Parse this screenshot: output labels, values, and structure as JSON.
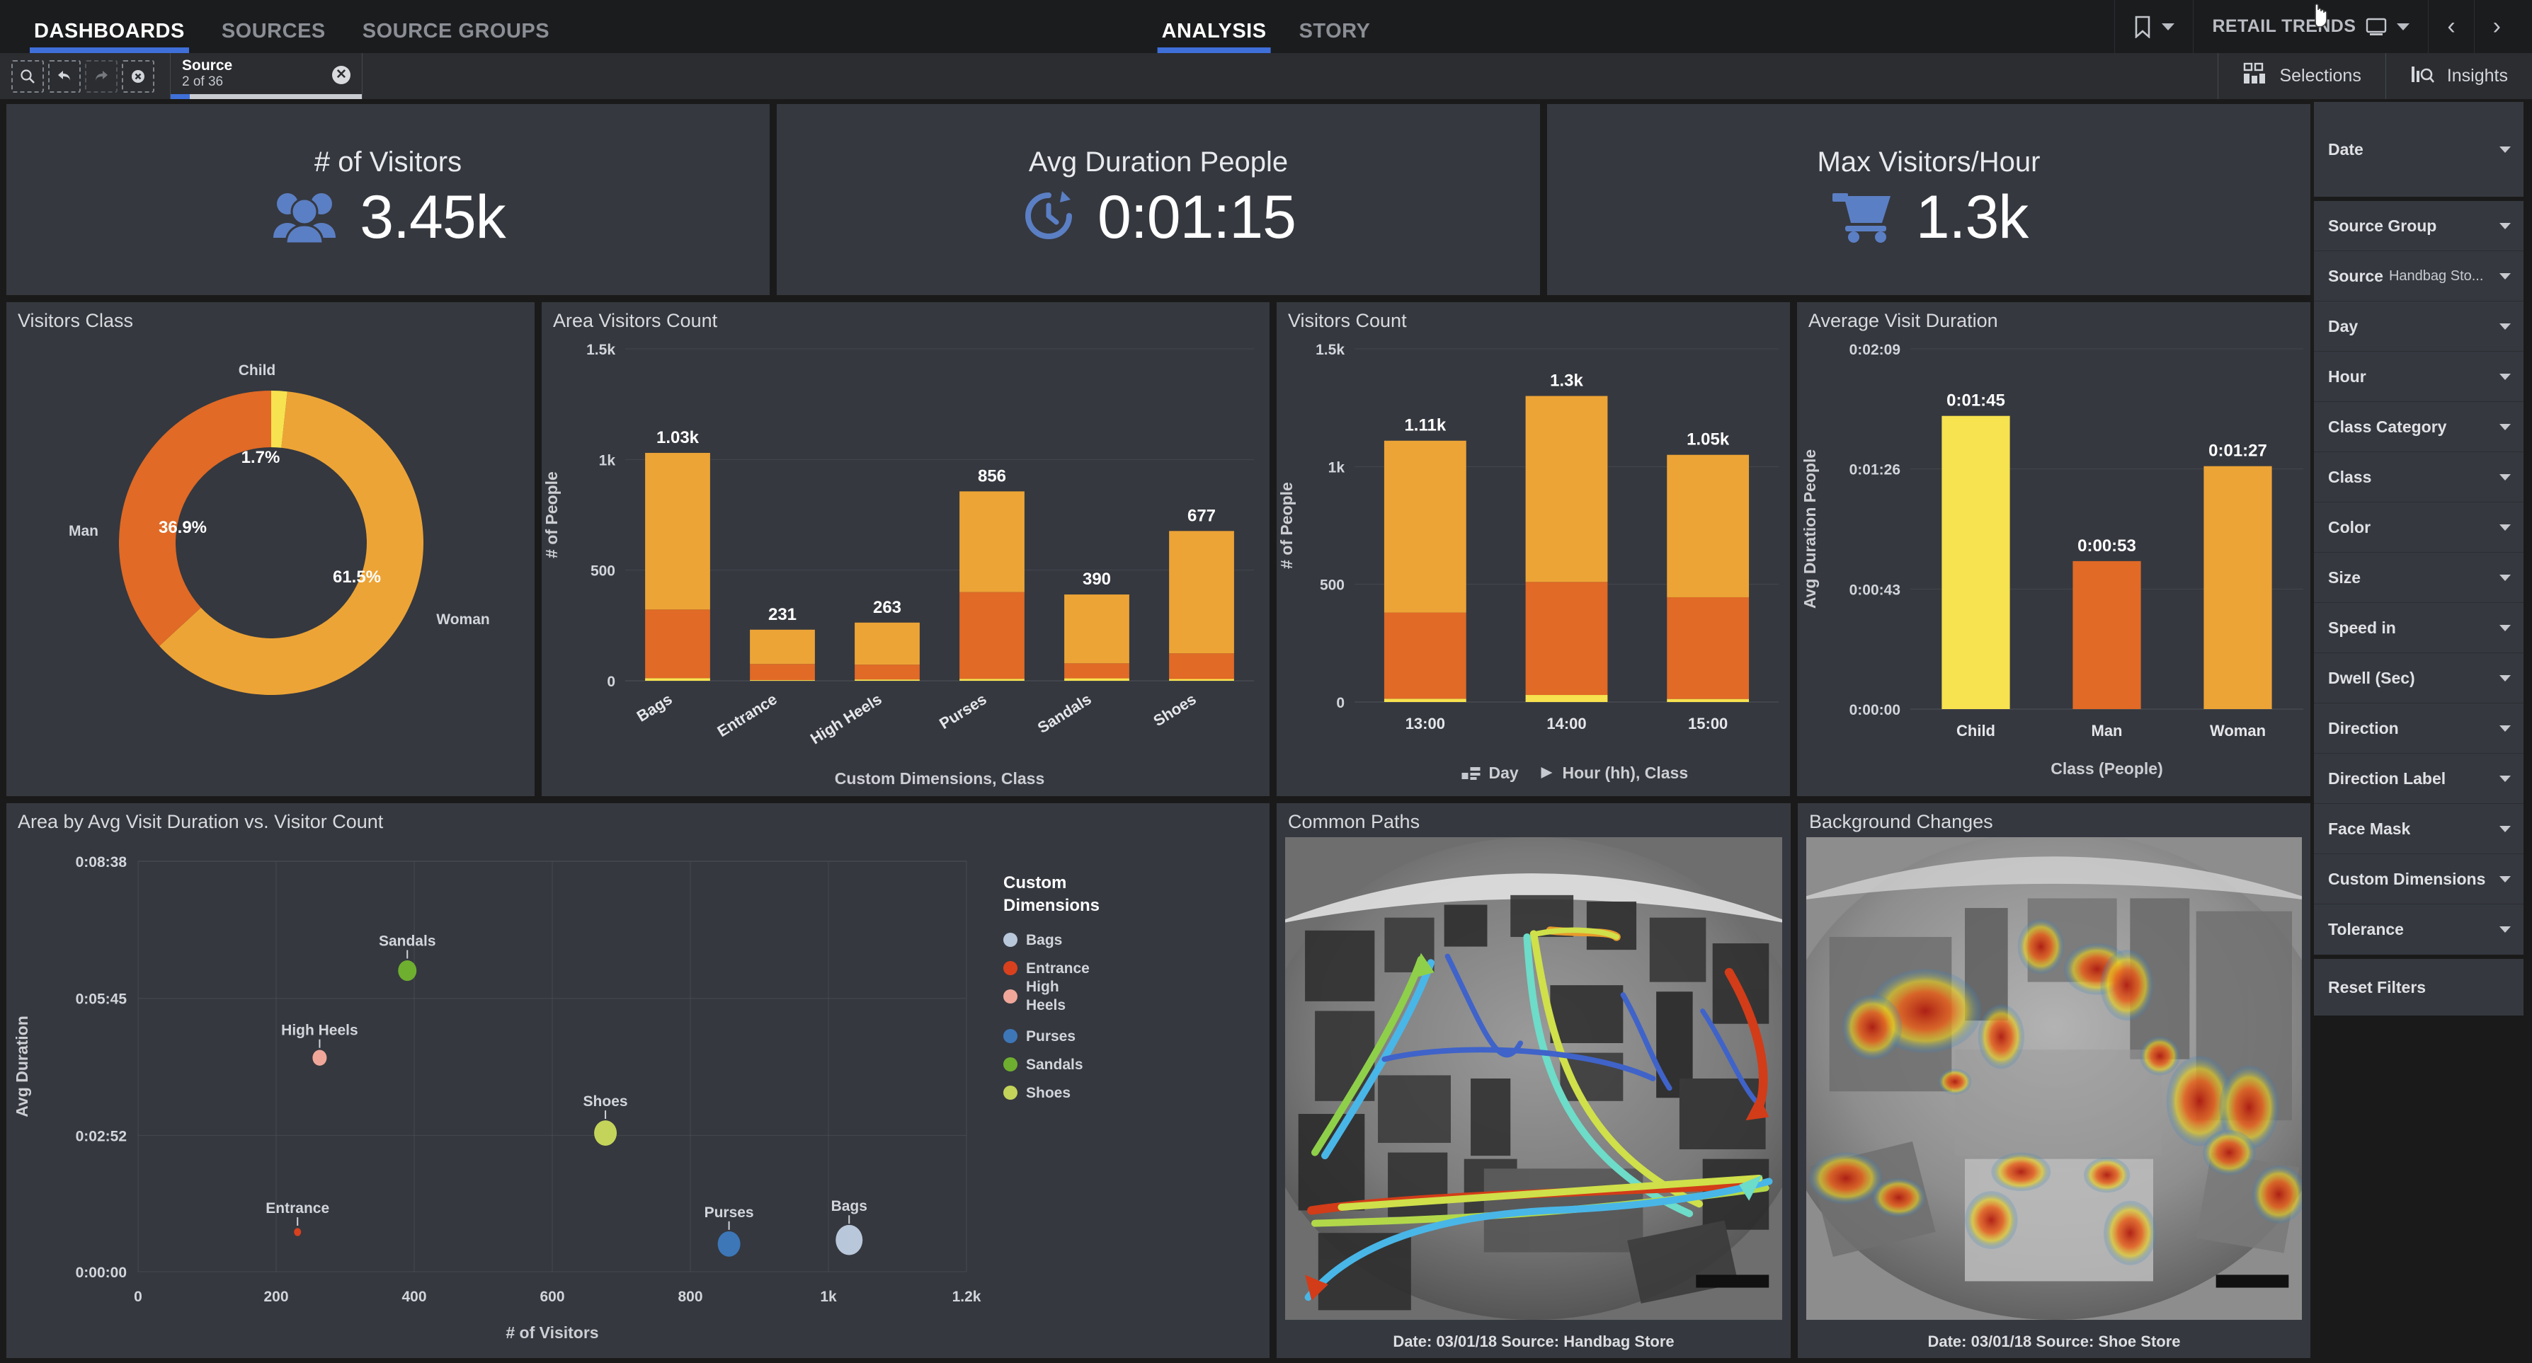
{
  "nav": {
    "left_items": [
      {
        "label": "DASHBOARDS",
        "active": true
      },
      {
        "label": "SOURCES",
        "active": false
      },
      {
        "label": "SOURCE GROUPS",
        "active": false
      }
    ],
    "center_items": [
      {
        "label": "ANALYSIS",
        "active": true
      },
      {
        "label": "STORY",
        "active": false
      }
    ],
    "bookmark_icon": "bookmark-icon",
    "sheet_title": "RETAIL TRENDS",
    "sheet_icon": "sheet-icon",
    "prev_label": "‹",
    "next_label": "›"
  },
  "toolbar": {
    "tools": [
      {
        "name": "search-selections-icon",
        "dim": false
      },
      {
        "name": "step-back-icon",
        "dim": false
      },
      {
        "name": "step-forward-icon",
        "dim": true
      },
      {
        "name": "clear-selections-icon",
        "dim": false
      }
    ],
    "selection_chip": {
      "field": "Source",
      "detail": "2 of 36",
      "clear": "✕"
    },
    "selections_label": "Selections",
    "insights_label": "Insights"
  },
  "kpis": [
    {
      "label": "# of Visitors",
      "value": "3.45k",
      "icon": "people-group-icon",
      "color": "#5b7fc4"
    },
    {
      "label": "Avg Duration People",
      "value": "0:01:15",
      "icon": "clock-refresh-icon",
      "color": "#5b7fc4"
    },
    {
      "label": "Max Visitors/Hour",
      "value": "1.3k",
      "icon": "shopping-cart-icon",
      "color": "#5b7fc4"
    }
  ],
  "panels": {
    "visitors_class": "Visitors Class",
    "area_visitors_count": "Area Visitors Count",
    "visitors_count": "Visitors Count",
    "average_visit_duration": "Average Visit Duration",
    "scatter": "Area by Avg Visit Duration vs. Visitor Count",
    "common_paths": "Common Paths",
    "background_changes": "Background Changes"
  },
  "common_paths_caption": "Date: 03/01/18 Source: Handbag Store",
  "background_changes_caption": "Date: 03/01/18 Source: Shoe Store",
  "filters": {
    "date": {
      "label": "Date"
    },
    "items": [
      {
        "label": "Source Group",
        "value": ""
      },
      {
        "label": "Source",
        "value": "Handbag Sto..."
      },
      {
        "label": "Day",
        "value": ""
      },
      {
        "label": "Hour",
        "value": ""
      },
      {
        "label": "Class Category",
        "value": ""
      },
      {
        "label": "Class",
        "value": ""
      },
      {
        "label": "Color",
        "value": ""
      },
      {
        "label": "Size",
        "value": ""
      },
      {
        "label": "Speed in",
        "value": ""
      },
      {
        "label": "Dwell (Sec)",
        "value": ""
      },
      {
        "label": "Direction",
        "value": ""
      },
      {
        "label": "Direction Label",
        "value": ""
      },
      {
        "label": "Face Mask",
        "value": ""
      },
      {
        "label": "Custom Dimensions",
        "value": ""
      },
      {
        "label": "Tolerance",
        "value": ""
      }
    ],
    "reset": "Reset Filters"
  },
  "chart_data": [
    {
      "id": "visitors_class",
      "type": "pie",
      "title": "Visitors Class",
      "labels": [
        "Child",
        "Man",
        "Woman"
      ],
      "values": [
        1.7,
        36.9,
        61.5
      ],
      "value_labels": [
        "1.7%",
        "36.9%",
        "61.5%"
      ],
      "colors": [
        "#f7e24f",
        "#e06a26",
        "#eda436"
      ],
      "donut": true,
      "legend": "labels-outside"
    },
    {
      "id": "area_visitors_count",
      "type": "bar",
      "title": "Area Visitors Count",
      "stacked": true,
      "categories": [
        "Bags",
        "Entrance",
        "High Heels",
        "Purses",
        "Sandals",
        "Shoes"
      ],
      "totals": [
        1030,
        231,
        263,
        856,
        390,
        677
      ],
      "total_labels": [
        "1.03k",
        "231",
        "263",
        "856",
        "390",
        "677"
      ],
      "series": [
        {
          "name": "Child",
          "color": "#f7e24f",
          "values": [
            12,
            3,
            6,
            9,
            11,
            8
          ]
        },
        {
          "name": "Man",
          "color": "#e06a26",
          "values": [
            310,
            73,
            67,
            392,
            68,
            116
          ]
        },
        {
          "name": "Woman",
          "color": "#eda436",
          "values": [
            708,
            155,
            190,
            455,
            311,
            553
          ]
        }
      ],
      "xlabel": "Custom Dimensions, Class",
      "ylabel": "# of People",
      "ylim": [
        0,
        1500
      ],
      "yticks": [
        0,
        500,
        1000,
        1500
      ],
      "ytick_labels": [
        "0",
        "500",
        "1k",
        "1.5k"
      ],
      "grid": true
    },
    {
      "id": "visitors_count",
      "type": "bar",
      "title": "Visitors Count",
      "stacked": true,
      "categories": [
        "13:00",
        "14:00",
        "15:00"
      ],
      "totals": [
        1110,
        1300,
        1050
      ],
      "total_labels": [
        "1.11k",
        "1.3k",
        "1.05k"
      ],
      "series": [
        {
          "name": "Child",
          "color": "#f7e24f",
          "values": [
            14,
            30,
            13
          ]
        },
        {
          "name": "Man",
          "color": "#e06a26",
          "values": [
            366,
            480,
            432
          ]
        },
        {
          "name": "Woman",
          "color": "#eda436",
          "values": [
            730,
            790,
            605
          ]
        }
      ],
      "xlabel": "Day ▶ Hour (hh), Class",
      "xlabel_prefix": "Day",
      "xlabel_suffix": "Hour (hh), Class",
      "ylabel": "# of People",
      "ylim": [
        0,
        1500
      ],
      "yticks": [
        0,
        500,
        1000,
        1500
      ],
      "ytick_labels": [
        "0",
        "500",
        "1k",
        "1.5k"
      ],
      "grid": true
    },
    {
      "id": "average_visit_duration",
      "type": "bar",
      "title": "Average Visit Duration",
      "categories": [
        "Child",
        "Man",
        "Woman"
      ],
      "values": [
        105,
        53,
        87
      ],
      "value_labels": [
        "0:01:45",
        "0:00:53",
        "0:01:27"
      ],
      "colors": [
        "#f7e24f",
        "#e06a26",
        "#eda436"
      ],
      "xlabel": "Class (People)",
      "ylabel": "Avg Duration People",
      "ylim": [
        0,
        129
      ],
      "yticks": [
        0,
        43,
        86,
        129
      ],
      "ytick_labels": [
        "0:00:00",
        "0:00:43",
        "0:01:26",
        "0:02:09"
      ],
      "grid": true
    },
    {
      "id": "scatter",
      "type": "scatter",
      "title": "Area by Avg Visit Duration vs. Visitor Count",
      "xlabel": "# of Visitors",
      "ylabel": "Avg Duration",
      "xlim": [
        0,
        1200
      ],
      "ylim": [
        0,
        518
      ],
      "xticks": [
        0,
        200,
        400,
        600,
        800,
        1000,
        1200
      ],
      "xtick_labels": [
        "0",
        "200",
        "400",
        "600",
        "800",
        "1k",
        "1.2k"
      ],
      "yticks": [
        0,
        172,
        345,
        518
      ],
      "ytick_labels": [
        "0:00:00",
        "0:02:52",
        "0:05:45",
        "0:08:38"
      ],
      "legend_title": "Custom Dimensions",
      "grid": true,
      "points": [
        {
          "label": "Bags",
          "x": 1030,
          "y": 40,
          "size": 19,
          "color": "#b9c7da"
        },
        {
          "label": "Entrance",
          "x": 231,
          "y": 50,
          "size": 5,
          "color": "#d9411e"
        },
        {
          "label": "High Heels",
          "x": 263,
          "y": 270,
          "size": 10,
          "color": "#f0a79a"
        },
        {
          "label": "Purses",
          "x": 856,
          "y": 35,
          "size": 16,
          "color": "#3d77b8"
        },
        {
          "label": "Sandals",
          "x": 390,
          "y": 380,
          "size": 13,
          "color": "#6faf2f"
        },
        {
          "label": "Shoes",
          "x": 677,
          "y": 175,
          "size": 16,
          "color": "#c4d45a"
        }
      ],
      "legend": [
        {
          "label": "Bags",
          "color": "#b9c7da"
        },
        {
          "label": "Entrance",
          "color": "#d9411e"
        },
        {
          "label": "High Heels",
          "color": "#f0a79a"
        },
        {
          "label": "Purses",
          "color": "#3d77b8"
        },
        {
          "label": "Sandals",
          "color": "#6faf2f"
        },
        {
          "label": "Shoes",
          "color": "#c4d45a"
        }
      ]
    }
  ]
}
